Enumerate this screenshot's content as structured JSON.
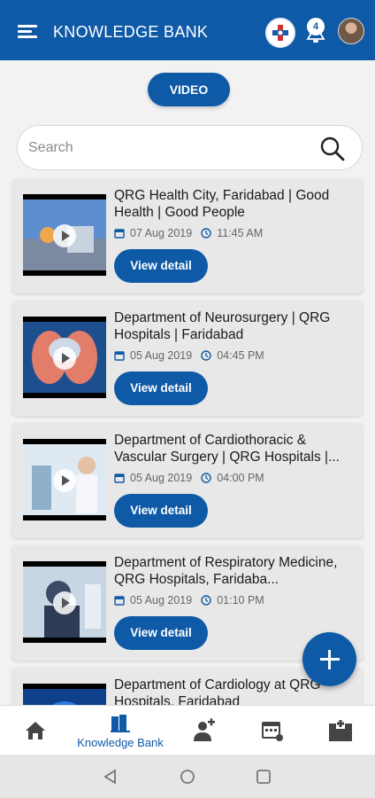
{
  "appbar": {
    "title": "KNOWLEDGE BANK",
    "notification_count": "4"
  },
  "tab": {
    "video_label": "VIDEO"
  },
  "search": {
    "placeholder": "Search"
  },
  "items": [
    {
      "title": "QRG Health City, Faridabad | Good Health | Good People",
      "date": "07 Aug 2019",
      "time": "11:45 AM",
      "button": "View detail"
    },
    {
      "title": "Department of Neurosurgery | QRG Hospitals | Faridabad",
      "date": "05 Aug 2019",
      "time": "04:45 PM",
      "button": "View detail"
    },
    {
      "title": "Department of Cardiothoracic & Vascular Surgery | QRG Hospitals |...",
      "date": "05 Aug 2019",
      "time": "04:00 PM",
      "button": "View detail"
    },
    {
      "title": "Department of Respiratory Medicine, QRG Hospitals, Faridaba...",
      "date": "05 Aug 2019",
      "time": "01:10 PM",
      "button": "View detail"
    },
    {
      "title": "Department of Cardiology at QRG Hospitals, Faridabad",
      "date": "",
      "time": "",
      "button": ""
    }
  ],
  "bottom_nav": {
    "active_label": "Knowledge Bank"
  },
  "colors": {
    "primary": "#0f5aa6",
    "card": "#e8e8e8"
  },
  "icons": [
    "menu-icon",
    "hospital-logo-icon",
    "bell-icon",
    "search-icon",
    "calendar-icon",
    "clock-icon",
    "play-icon",
    "home-icon",
    "knowledge-bank-icon",
    "doctor-icon",
    "appointment-icon",
    "hospital-icon",
    "back-icon",
    "home-circle-icon",
    "recents-icon"
  ]
}
